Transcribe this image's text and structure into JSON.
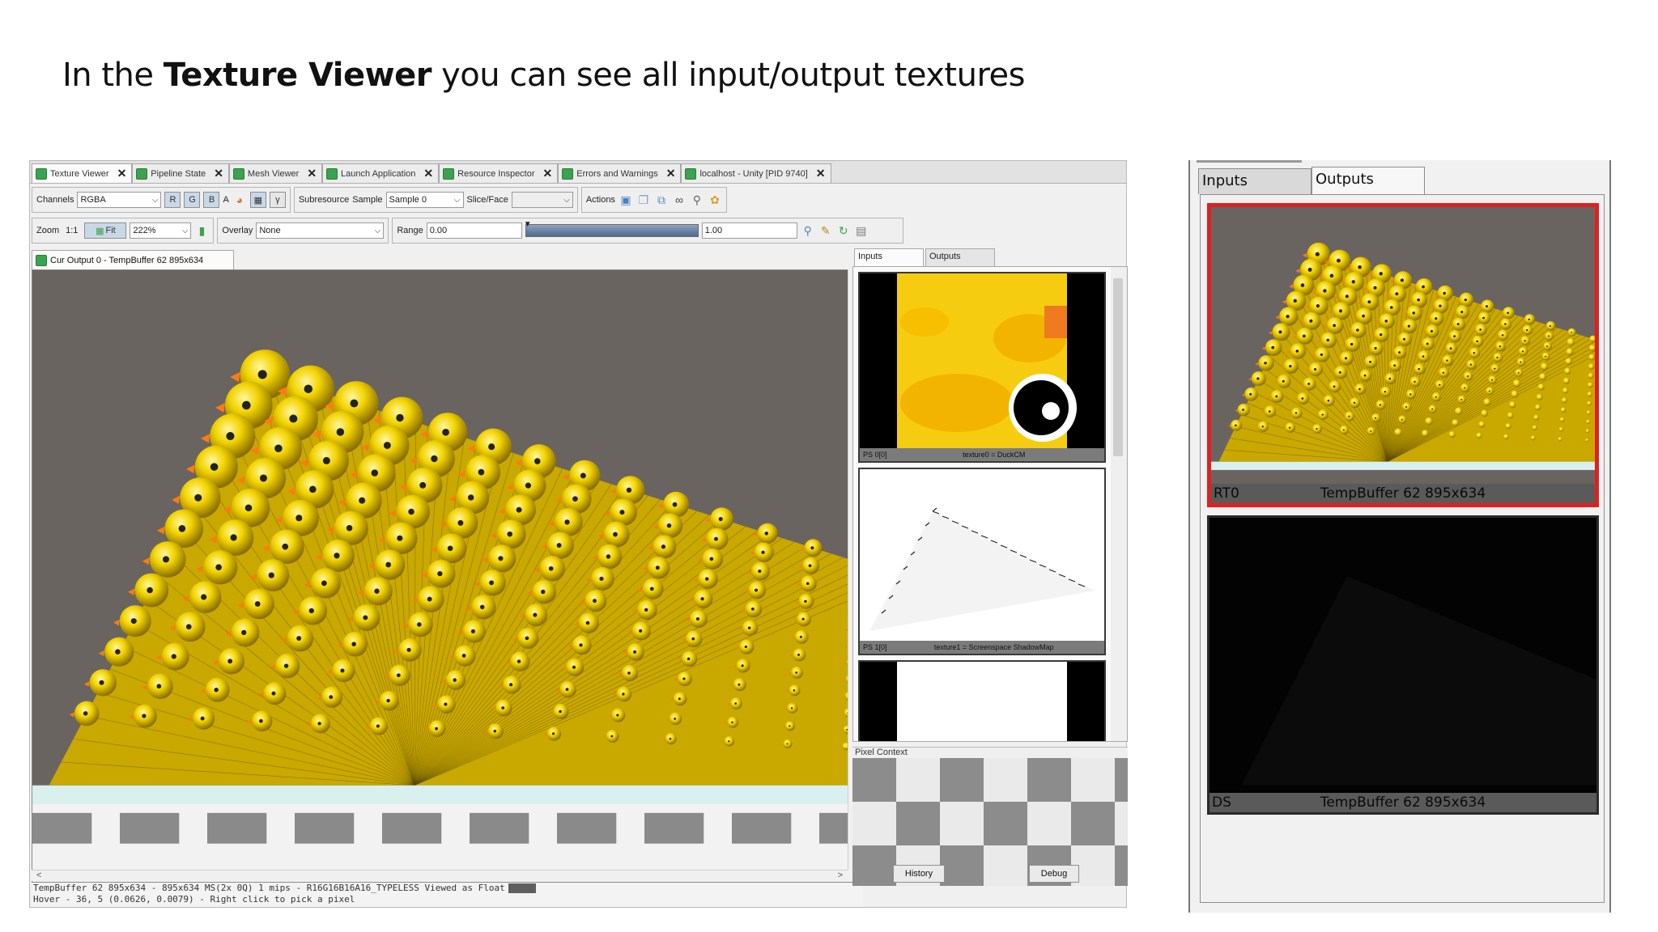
{
  "slide": {
    "title_pre": "In the ",
    "title_bold": "Texture Viewer",
    "title_post": " you can see all input/output textures"
  },
  "tabs": [
    {
      "label": "Texture Viewer",
      "active": true
    },
    {
      "label": "Pipeline State"
    },
    {
      "label": "Mesh Viewer"
    },
    {
      "label": "Launch Application"
    },
    {
      "label": "Resource Inspector"
    },
    {
      "label": "Errors and Warnings"
    },
    {
      "label": "localhost - Unity [PID 9740]"
    }
  ],
  "toolbar1": {
    "channels_label": "Channels",
    "channels_value": "RGBA",
    "r": "R",
    "g": "G",
    "b": "B",
    "a": "A",
    "gamma": "γ",
    "subresource_label": "Subresource",
    "sample_label": "Sample",
    "sample_value": "Sample 0",
    "slice_label": "Slice/Face",
    "actions_label": "Actions"
  },
  "toolbar2": {
    "zoom_label": "Zoom",
    "zoom_11": "1:1",
    "fit_label": "Fit",
    "zoom_value": "222%",
    "overlay_label": "Overlay",
    "overlay_value": "None",
    "range_label": "Range",
    "range_min": "0.00",
    "range_max": "1.00"
  },
  "viewer_tab": "Cur Output 0 - TempBuffer 62 895x634",
  "status": {
    "line1": "TempBuffer 62 895x634 - 895x634 MS(2x 0Q) 1 mips - R16G16B16A16_TYPELESS Viewed as Float",
    "line2": "Hover -   36,    5 (0.0626, 0.0079) - Right click to pick a pixel",
    "swatch_color": "#5e5e5e"
  },
  "inputs_panel": {
    "tab_inputs": "Inputs",
    "tab_outputs": "Outputs",
    "thumbs": [
      {
        "slot": "PS 0[0]",
        "name": "texture0 = DuckCM"
      },
      {
        "slot": "PS 1[0]",
        "name": "texture1 = Screenspace ShadowMap"
      }
    ]
  },
  "pixel_context": {
    "label": "Pixel Context",
    "history_button": "History",
    "debug_button": "Debug"
  },
  "zoom_panel": {
    "tab_inputs": "Inputs",
    "tab_outputs": "Outputs",
    "outputs": [
      {
        "slot": "RT0",
        "name": "TempBuffer 62 895x634"
      },
      {
        "slot": "DS",
        "name": "TempBuffer 62 895x634"
      }
    ]
  },
  "colors": {
    "selection_border": "#e02020",
    "viewport_bg": "#6a6461",
    "duck_yellow": "#f2d400"
  }
}
